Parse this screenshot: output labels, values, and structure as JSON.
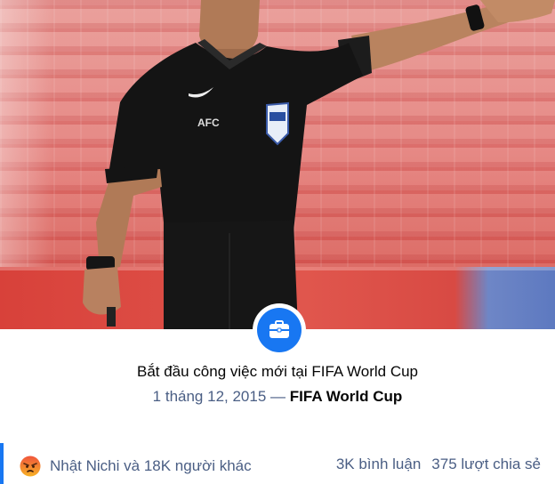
{
  "post": {
    "photo_alt": "referee-photo",
    "event_title": "Bắt đầu công việc mới tại FIFA World Cup",
    "date": "1 tháng 12, 2015",
    "separator": "—",
    "organization": "FIFA World Cup",
    "icon": "briefcase-icon"
  },
  "footer": {
    "reaction_icon": "angry-emoji-icon",
    "reactors_text": "Nhật Nichi và 18K người khác",
    "comments_text": "3K bình luận",
    "shares_text": "375 lượt chia sẻ"
  },
  "colors": {
    "accent": "#1877f2",
    "secondary_text": "#4a5e84",
    "primary_text": "#050505"
  }
}
